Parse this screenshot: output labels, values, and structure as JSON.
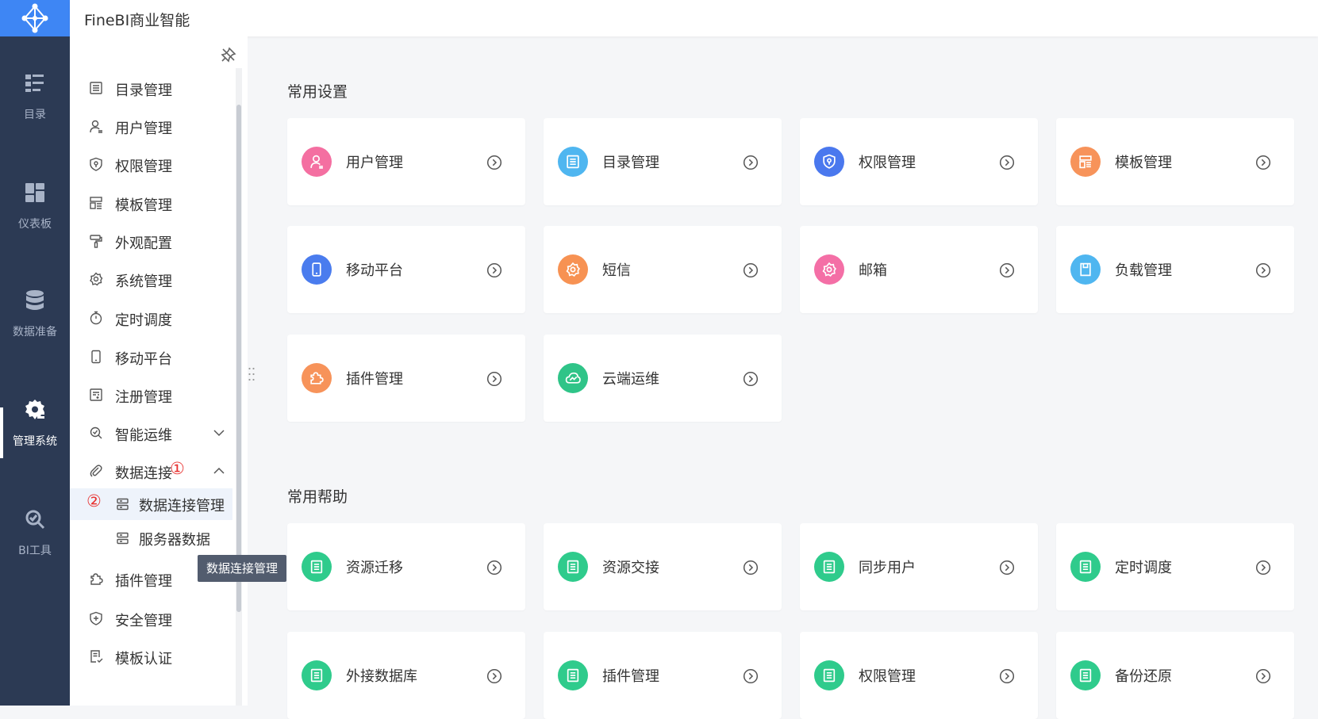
{
  "app": {
    "title": "FineBI商业智能"
  },
  "rail": {
    "items": [
      {
        "label": "目录",
        "icon": "catalog-icon"
      },
      {
        "label": "仪表板",
        "icon": "dashboard-icon"
      },
      {
        "label": "数据准备",
        "icon": "database-icon"
      },
      {
        "label": "管理系统",
        "icon": "gear-icon",
        "active": true
      },
      {
        "label": "BI工具",
        "icon": "tools-icon"
      }
    ]
  },
  "sidebar": {
    "items": [
      {
        "label": "目录管理",
        "icon": "list-icon"
      },
      {
        "label": "用户管理",
        "icon": "user-icon"
      },
      {
        "label": "权限管理",
        "icon": "shield-icon"
      },
      {
        "label": "模板管理",
        "icon": "template-icon"
      },
      {
        "label": "外观配置",
        "icon": "paint-roller-icon"
      },
      {
        "label": "系统管理",
        "icon": "gear-icon"
      },
      {
        "label": "定时调度",
        "icon": "stopwatch-icon"
      },
      {
        "label": "移动平台",
        "icon": "phone-icon"
      },
      {
        "label": "注册管理",
        "icon": "register-icon"
      },
      {
        "label": "智能运维",
        "icon": "ops-icon"
      },
      {
        "label": "数据连接",
        "icon": "paperclip-icon"
      },
      {
        "label": "插件管理",
        "icon": "puzzle-icon"
      },
      {
        "label": "安全管理",
        "icon": "security-icon"
      },
      {
        "label": "模板认证",
        "icon": "certificate-icon"
      }
    ],
    "sub_items": [
      {
        "label": "数据连接管理",
        "icon": "server-icon",
        "active": true
      },
      {
        "label": "服务器数据",
        "icon": "server-icon"
      }
    ],
    "marker_1": "①",
    "marker_2": "②",
    "tooltip": "数据连接管理"
  },
  "main": {
    "common_settings_title": "常用设置",
    "common_settings": [
      {
        "label": "用户管理",
        "icon": "user-icon",
        "color": "#F46FA1"
      },
      {
        "label": "目录管理",
        "icon": "list-icon",
        "color": "#4FB6F0"
      },
      {
        "label": "权限管理",
        "icon": "shield-icon",
        "color": "#4A78EE"
      },
      {
        "label": "模板管理",
        "icon": "template-icon",
        "color": "#F7935A"
      },
      {
        "label": "移动平台",
        "icon": "phone-icon",
        "color": "#4A7CEE"
      },
      {
        "label": "短信",
        "icon": "gear-icon",
        "color": "#F79253"
      },
      {
        "label": "邮箱",
        "icon": "gear-icon",
        "color": "#F46FA6"
      },
      {
        "label": "负载管理",
        "icon": "storage-icon",
        "color": "#4FB6F0"
      },
      {
        "label": "插件管理",
        "icon": "puzzle-icon",
        "color": "#F7935A"
      },
      {
        "label": "云端运维",
        "icon": "cloud-icon",
        "color": "#2FC488"
      }
    ],
    "common_help_title": "常用帮助",
    "common_help": [
      {
        "label": "资源迁移",
        "icon": "doc-icon",
        "color": "#2FCB8C"
      },
      {
        "label": "资源交接",
        "icon": "doc-icon",
        "color": "#2FCB8C"
      },
      {
        "label": "同步用户",
        "icon": "doc-icon",
        "color": "#2FCB8C"
      },
      {
        "label": "定时调度",
        "icon": "doc-icon",
        "color": "#2FCB8C"
      },
      {
        "label": "外接数据库",
        "icon": "doc-icon",
        "color": "#2FCB8C"
      },
      {
        "label": "插件管理",
        "icon": "doc-icon",
        "color": "#2FCB8C"
      },
      {
        "label": "权限管理",
        "icon": "doc-icon",
        "color": "#2FCB8C"
      },
      {
        "label": "备份还原",
        "icon": "doc-icon",
        "color": "#2FCB8C"
      }
    ]
  }
}
